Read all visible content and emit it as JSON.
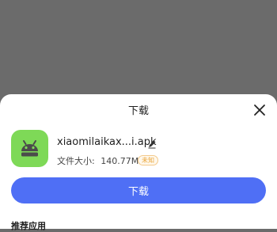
{
  "sheet": {
    "title": "下载",
    "close_icon": "close-icon",
    "file": {
      "name": "xiaomilaikax...i.apk",
      "size_label": "文件大小:",
      "size_value": "140.77MB",
      "badge": "未知",
      "app_icon": "android-icon",
      "edit_icon": "edit-icon"
    },
    "download_button_label": "下载",
    "recommend_heading": "推荐应用"
  },
  "colors": {
    "overlay": "#6b6b6b",
    "accent": "#4f6ff5",
    "app_icon_bg": "#7ed957",
    "badge": "#e9a53a"
  }
}
